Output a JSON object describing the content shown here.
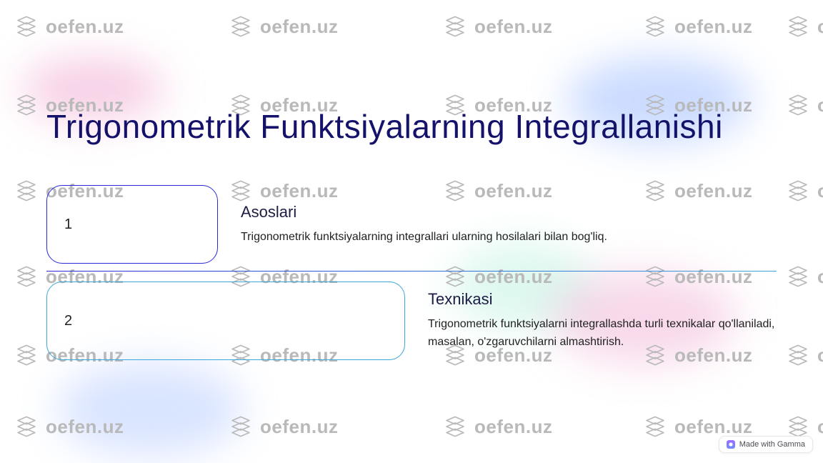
{
  "watermark_text": "oefen.uz",
  "title": "Trigonometrik Funktsiyalarning Integrallanishi",
  "rows": [
    {
      "num": "1",
      "heading": "Asoslari",
      "body": "Trigonometrik funktsiyalarning integrallari ularning hosilalari bilan bog'liq."
    },
    {
      "num": "2",
      "heading": "Texnikasi",
      "body": "Trigonometrik funktsiyalarni integrallashda turli texnikalar qo'llaniladi, masalan, o'zgaruvchilarni almashtirish."
    }
  ],
  "badge_label": "Made with Gamma"
}
